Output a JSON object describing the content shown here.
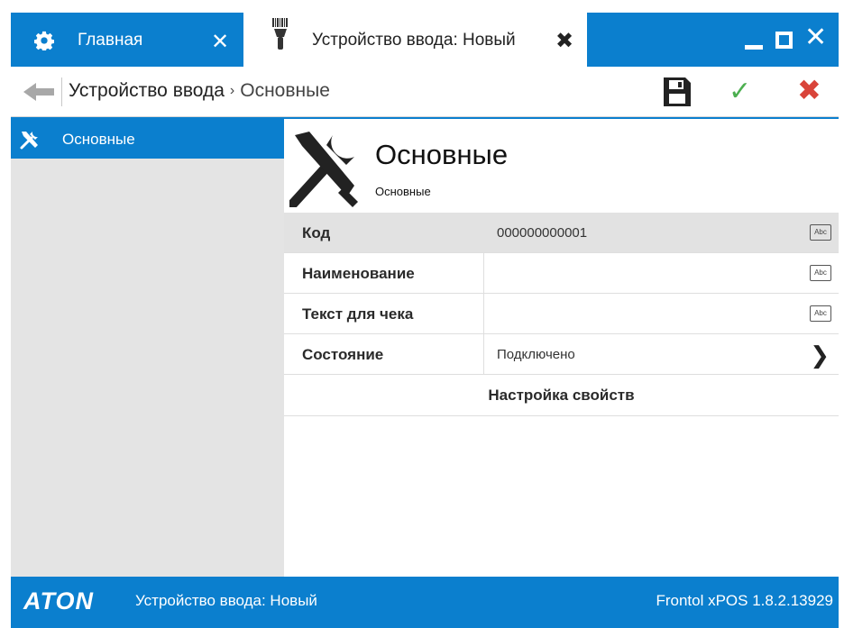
{
  "tabs": [
    {
      "label": "Главная",
      "icon": "gear-icon",
      "close": "✕",
      "active": false
    },
    {
      "label": "Устройство ввода: Новый",
      "icon": "barcode-scanner-icon",
      "close": "✖",
      "active": true
    }
  ],
  "window_controls": {
    "minimize": "minimize-icon",
    "maximize": "maximize-icon",
    "close": "✕"
  },
  "breadcrumb": {
    "root": "Устройство ввода",
    "separator": "›",
    "current": "Основные"
  },
  "toolbar": {
    "save": "save-icon",
    "ok": "✓",
    "cancel": "✖"
  },
  "sidebar": {
    "items": [
      {
        "label": "Основные",
        "icon": "tools-icon",
        "selected": true
      }
    ]
  },
  "header": {
    "title": "Основные",
    "subtitle": "Основные",
    "icon": "tools-icon"
  },
  "fields": [
    {
      "label": "Код",
      "value": "000000000001",
      "button": "Abc"
    },
    {
      "label": "Наименование",
      "value": "",
      "button": "Abc"
    },
    {
      "label": "Текст для чека",
      "value": "",
      "button": "Abc"
    },
    {
      "label": "Состояние",
      "value": "Подключено",
      "button": "❯"
    }
  ],
  "setup_button": "Настройка свойств",
  "statusbar": {
    "logo": "ATON",
    "text": "Устройство ввода: Новый",
    "version": "Frontol xPOS 1.8.2.13929"
  },
  "colors": {
    "accent": "#0b7fce",
    "ok": "#4caf50",
    "cancel": "#d9443a",
    "sidebar_bg": "#e4e4e4"
  }
}
